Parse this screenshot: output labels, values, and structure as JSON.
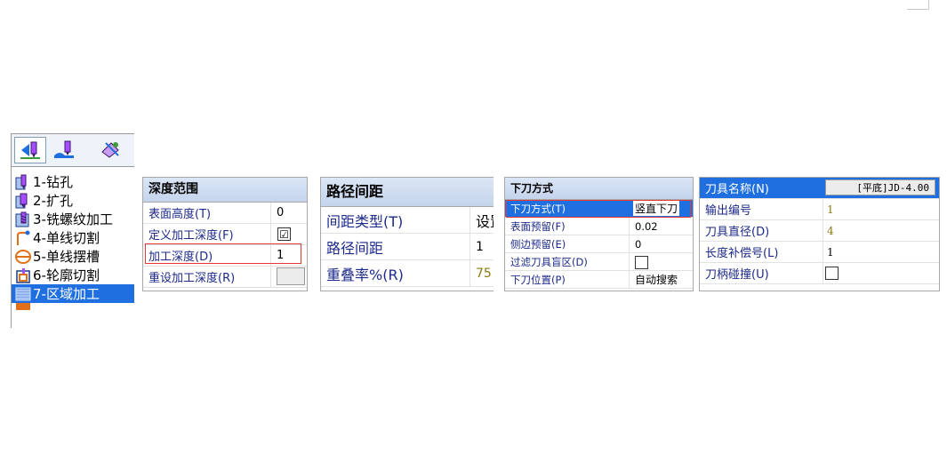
{
  "toolbar": {
    "buttons": [
      {
        "icon": "2-axis-machining-icon"
      },
      {
        "icon": "3-axis-machining-icon"
      },
      {
        "icon": "multi-axis-machining-icon"
      }
    ]
  },
  "machining_list": {
    "items": [
      {
        "label": "1-钻孔",
        "icon": "drill-icon"
      },
      {
        "label": "2-扩孔",
        "icon": "ream-icon"
      },
      {
        "label": "3-铣螺纹加工",
        "icon": "thread-mill-icon"
      },
      {
        "label": "4-单线切割",
        "icon": "line-cut-icon"
      },
      {
        "label": "5-单线摆槽",
        "icon": "slot-icon"
      },
      {
        "label": "6-轮廓切割",
        "icon": "contour-cut-icon"
      },
      {
        "label": "7-区域加工",
        "icon": "area-machining-icon"
      }
    ],
    "selected_index": 6
  },
  "depth_panel": {
    "title": "深度范围",
    "rows": [
      {
        "label": "表面高度(T)",
        "value": "0"
      },
      {
        "label": "定义加工深度(F)",
        "value": "☑"
      },
      {
        "label": "加工深度(D)",
        "value": "1"
      },
      {
        "label": "重设加工深度(R)",
        "value": ""
      }
    ]
  },
  "path_panel": {
    "title": "路径间距",
    "rows": [
      {
        "label": "间距类型(T)",
        "value": "设置"
      },
      {
        "label": "路径间距",
        "value": "1"
      },
      {
        "label": "重叠率%(R)",
        "value": "75"
      }
    ]
  },
  "cut_panel": {
    "title": "下刀方式",
    "rows": [
      {
        "label": "下刀方式(T)",
        "value": "竖直下刀"
      },
      {
        "label": "表面预留(F)",
        "value": "0.02"
      },
      {
        "label": "侧边预留(E)",
        "value": "0"
      },
      {
        "label": "过滤刀具盲区(D)",
        "value": ""
      },
      {
        "label": "下刀位置(P)",
        "value": "自动搜索"
      }
    ]
  },
  "tool_panel": {
    "rows": [
      {
        "label": "刀具名称(N)",
        "value": "[平底]JD-4.00"
      },
      {
        "label": "输出编号",
        "value": "1"
      },
      {
        "label": "刀具直径(D)",
        "value": "4"
      },
      {
        "label": "长度补偿号(L)",
        "value": "1"
      },
      {
        "label": "刀柄碰撞(U)",
        "value": ""
      }
    ]
  },
  "colors": {
    "selection": "#1f6fe0",
    "highlight_box": "#e53935",
    "header": "#c4d4ec",
    "olive_value": "#8a7a10"
  }
}
